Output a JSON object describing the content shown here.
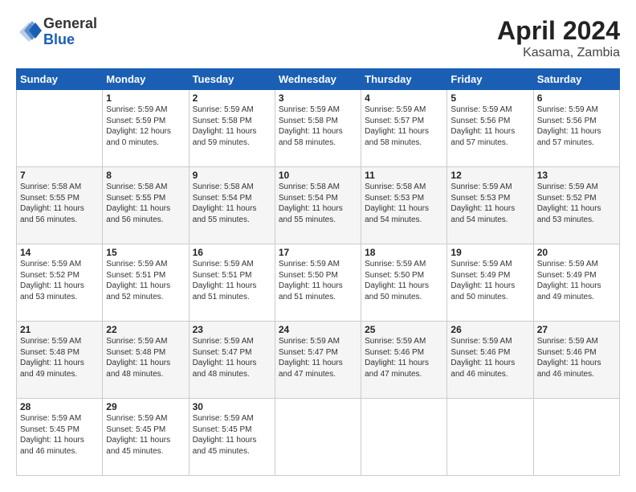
{
  "header": {
    "logo_general": "General",
    "logo_blue": "Blue",
    "month_title": "April 2024",
    "location": "Kasama, Zambia"
  },
  "weekdays": [
    "Sunday",
    "Monday",
    "Tuesday",
    "Wednesday",
    "Thursday",
    "Friday",
    "Saturday"
  ],
  "weeks": [
    [
      {
        "day": "",
        "sunrise": "",
        "sunset": "",
        "daylight": ""
      },
      {
        "day": "1",
        "sunrise": "Sunrise: 5:59 AM",
        "sunset": "Sunset: 5:59 PM",
        "daylight": "Daylight: 12 hours and 0 minutes."
      },
      {
        "day": "2",
        "sunrise": "Sunrise: 5:59 AM",
        "sunset": "Sunset: 5:58 PM",
        "daylight": "Daylight: 11 hours and 59 minutes."
      },
      {
        "day": "3",
        "sunrise": "Sunrise: 5:59 AM",
        "sunset": "Sunset: 5:58 PM",
        "daylight": "Daylight: 11 hours and 58 minutes."
      },
      {
        "day": "4",
        "sunrise": "Sunrise: 5:59 AM",
        "sunset": "Sunset: 5:57 PM",
        "daylight": "Daylight: 11 hours and 58 minutes."
      },
      {
        "day": "5",
        "sunrise": "Sunrise: 5:59 AM",
        "sunset": "Sunset: 5:56 PM",
        "daylight": "Daylight: 11 hours and 57 minutes."
      },
      {
        "day": "6",
        "sunrise": "Sunrise: 5:59 AM",
        "sunset": "Sunset: 5:56 PM",
        "daylight": "Daylight: 11 hours and 57 minutes."
      }
    ],
    [
      {
        "day": "7",
        "sunrise": "Sunrise: 5:58 AM",
        "sunset": "Sunset: 5:55 PM",
        "daylight": "Daylight: 11 hours and 56 minutes."
      },
      {
        "day": "8",
        "sunrise": "Sunrise: 5:58 AM",
        "sunset": "Sunset: 5:55 PM",
        "daylight": "Daylight: 11 hours and 56 minutes."
      },
      {
        "day": "9",
        "sunrise": "Sunrise: 5:58 AM",
        "sunset": "Sunset: 5:54 PM",
        "daylight": "Daylight: 11 hours and 55 minutes."
      },
      {
        "day": "10",
        "sunrise": "Sunrise: 5:58 AM",
        "sunset": "Sunset: 5:54 PM",
        "daylight": "Daylight: 11 hours and 55 minutes."
      },
      {
        "day": "11",
        "sunrise": "Sunrise: 5:58 AM",
        "sunset": "Sunset: 5:53 PM",
        "daylight": "Daylight: 11 hours and 54 minutes."
      },
      {
        "day": "12",
        "sunrise": "Sunrise: 5:59 AM",
        "sunset": "Sunset: 5:53 PM",
        "daylight": "Daylight: 11 hours and 54 minutes."
      },
      {
        "day": "13",
        "sunrise": "Sunrise: 5:59 AM",
        "sunset": "Sunset: 5:52 PM",
        "daylight": "Daylight: 11 hours and 53 minutes."
      }
    ],
    [
      {
        "day": "14",
        "sunrise": "Sunrise: 5:59 AM",
        "sunset": "Sunset: 5:52 PM",
        "daylight": "Daylight: 11 hours and 53 minutes."
      },
      {
        "day": "15",
        "sunrise": "Sunrise: 5:59 AM",
        "sunset": "Sunset: 5:51 PM",
        "daylight": "Daylight: 11 hours and 52 minutes."
      },
      {
        "day": "16",
        "sunrise": "Sunrise: 5:59 AM",
        "sunset": "Sunset: 5:51 PM",
        "daylight": "Daylight: 11 hours and 51 minutes."
      },
      {
        "day": "17",
        "sunrise": "Sunrise: 5:59 AM",
        "sunset": "Sunset: 5:50 PM",
        "daylight": "Daylight: 11 hours and 51 minutes."
      },
      {
        "day": "18",
        "sunrise": "Sunrise: 5:59 AM",
        "sunset": "Sunset: 5:50 PM",
        "daylight": "Daylight: 11 hours and 50 minutes."
      },
      {
        "day": "19",
        "sunrise": "Sunrise: 5:59 AM",
        "sunset": "Sunset: 5:49 PM",
        "daylight": "Daylight: 11 hours and 50 minutes."
      },
      {
        "day": "20",
        "sunrise": "Sunrise: 5:59 AM",
        "sunset": "Sunset: 5:49 PM",
        "daylight": "Daylight: 11 hours and 49 minutes."
      }
    ],
    [
      {
        "day": "21",
        "sunrise": "Sunrise: 5:59 AM",
        "sunset": "Sunset: 5:48 PM",
        "daylight": "Daylight: 11 hours and 49 minutes."
      },
      {
        "day": "22",
        "sunrise": "Sunrise: 5:59 AM",
        "sunset": "Sunset: 5:48 PM",
        "daylight": "Daylight: 11 hours and 48 minutes."
      },
      {
        "day": "23",
        "sunrise": "Sunrise: 5:59 AM",
        "sunset": "Sunset: 5:47 PM",
        "daylight": "Daylight: 11 hours and 48 minutes."
      },
      {
        "day": "24",
        "sunrise": "Sunrise: 5:59 AM",
        "sunset": "Sunset: 5:47 PM",
        "daylight": "Daylight: 11 hours and 47 minutes."
      },
      {
        "day": "25",
        "sunrise": "Sunrise: 5:59 AM",
        "sunset": "Sunset: 5:46 PM",
        "daylight": "Daylight: 11 hours and 47 minutes."
      },
      {
        "day": "26",
        "sunrise": "Sunrise: 5:59 AM",
        "sunset": "Sunset: 5:46 PM",
        "daylight": "Daylight: 11 hours and 46 minutes."
      },
      {
        "day": "27",
        "sunrise": "Sunrise: 5:59 AM",
        "sunset": "Sunset: 5:46 PM",
        "daylight": "Daylight: 11 hours and 46 minutes."
      }
    ],
    [
      {
        "day": "28",
        "sunrise": "Sunrise: 5:59 AM",
        "sunset": "Sunset: 5:45 PM",
        "daylight": "Daylight: 11 hours and 46 minutes."
      },
      {
        "day": "29",
        "sunrise": "Sunrise: 5:59 AM",
        "sunset": "Sunset: 5:45 PM",
        "daylight": "Daylight: 11 hours and 45 minutes."
      },
      {
        "day": "30",
        "sunrise": "Sunrise: 5:59 AM",
        "sunset": "Sunset: 5:45 PM",
        "daylight": "Daylight: 11 hours and 45 minutes."
      },
      {
        "day": "",
        "sunrise": "",
        "sunset": "",
        "daylight": ""
      },
      {
        "day": "",
        "sunrise": "",
        "sunset": "",
        "daylight": ""
      },
      {
        "day": "",
        "sunrise": "",
        "sunset": "",
        "daylight": ""
      },
      {
        "day": "",
        "sunrise": "",
        "sunset": "",
        "daylight": ""
      }
    ]
  ]
}
